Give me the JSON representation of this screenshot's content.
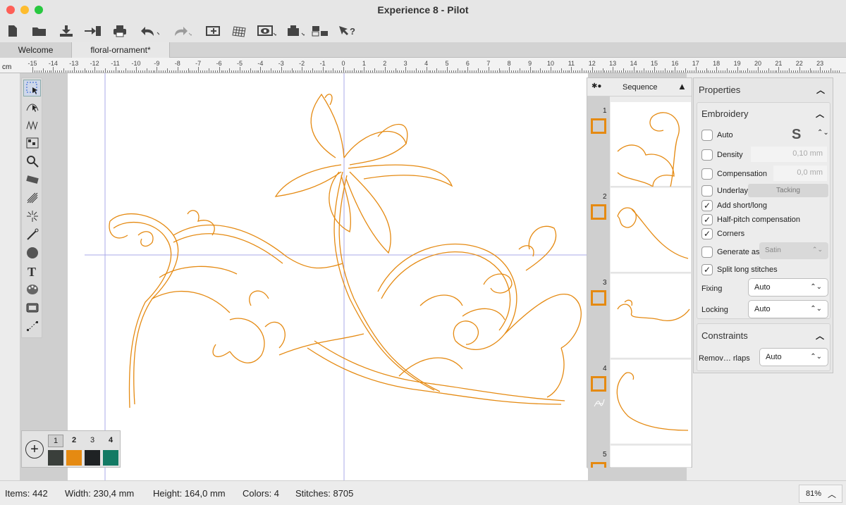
{
  "window": {
    "title": "Experience 8 - Pilot"
  },
  "toolbar": {
    "icons": [
      "new-file",
      "open-folder",
      "save",
      "import",
      "print",
      "undo",
      "redo",
      "paste",
      "grid",
      "view",
      "hoop",
      "split",
      "help"
    ]
  },
  "tabs": [
    {
      "label": "Welcome"
    },
    {
      "label": "floral-ornament*"
    }
  ],
  "ruler": {
    "unit": "cm",
    "labels": [
      "-15",
      "-14",
      "-13",
      "-12",
      "-11",
      "-10",
      "-9",
      "-8",
      "-7",
      "-6",
      "-5",
      "-4",
      "-3",
      "-2",
      "-1",
      "0",
      "1",
      "2",
      "3",
      "4",
      "5",
      "6",
      "7",
      "8",
      "9",
      "10",
      "11",
      "12",
      "13",
      "14",
      "15",
      "16",
      "17",
      "18",
      "19",
      "20",
      "21",
      "22",
      "23"
    ]
  },
  "tools": [
    "select-tool",
    "bezier-tool",
    "stitch-tool",
    "pattern-tool",
    "zoom-tool",
    "measure-tool",
    "fill-tool",
    "sparkle-tool",
    "needle-tool",
    "circle-tool",
    "text-tool",
    "palette-tool",
    "frame-tool",
    "node-tool"
  ],
  "palette": {
    "add_label": "+",
    "colors": [
      {
        "number": "1",
        "color": "#3a3f3b"
      },
      {
        "number": "2",
        "color": "#e58a12"
      },
      {
        "number": "3",
        "color": "#1f2224"
      },
      {
        "number": "4",
        "color": "#137a64"
      }
    ]
  },
  "sequence": {
    "title": "Sequence",
    "items": [
      {
        "number": "1"
      },
      {
        "number": "2"
      },
      {
        "number": "3"
      },
      {
        "number": "4"
      },
      {
        "number": "5"
      }
    ]
  },
  "properties": {
    "title": "Properties",
    "embroidery": {
      "title": "Embroidery",
      "auto": "Auto",
      "density": "Density",
      "density_value": "0,10 mm",
      "compensation": "Compensation",
      "compensation_value": "0,0 mm",
      "underlay": "Underlay",
      "underlay_value": "Tacking",
      "add_short_long": "Add short/long",
      "half_pitch": "Half-pitch compensation",
      "corners": "Corners",
      "generate_as": "Generate as:",
      "generate_as_value": "Satin",
      "split_long": "Split long stitches",
      "fixing": "Fixing",
      "fixing_value": "Auto",
      "locking": "Locking",
      "locking_value": "Auto"
    },
    "constraints": {
      "title": "Constraints",
      "remove_overlaps": "Remov… rlaps",
      "remove_overlaps_value": "Auto"
    }
  },
  "status": {
    "items": "Items: 442",
    "width": "Width: 230,4 mm",
    "height": "Height: 164,0 mm",
    "colors": "Colors: 4",
    "stitches": "Stitches: 8705",
    "zoom": "81%"
  },
  "accent": "#e58a12"
}
